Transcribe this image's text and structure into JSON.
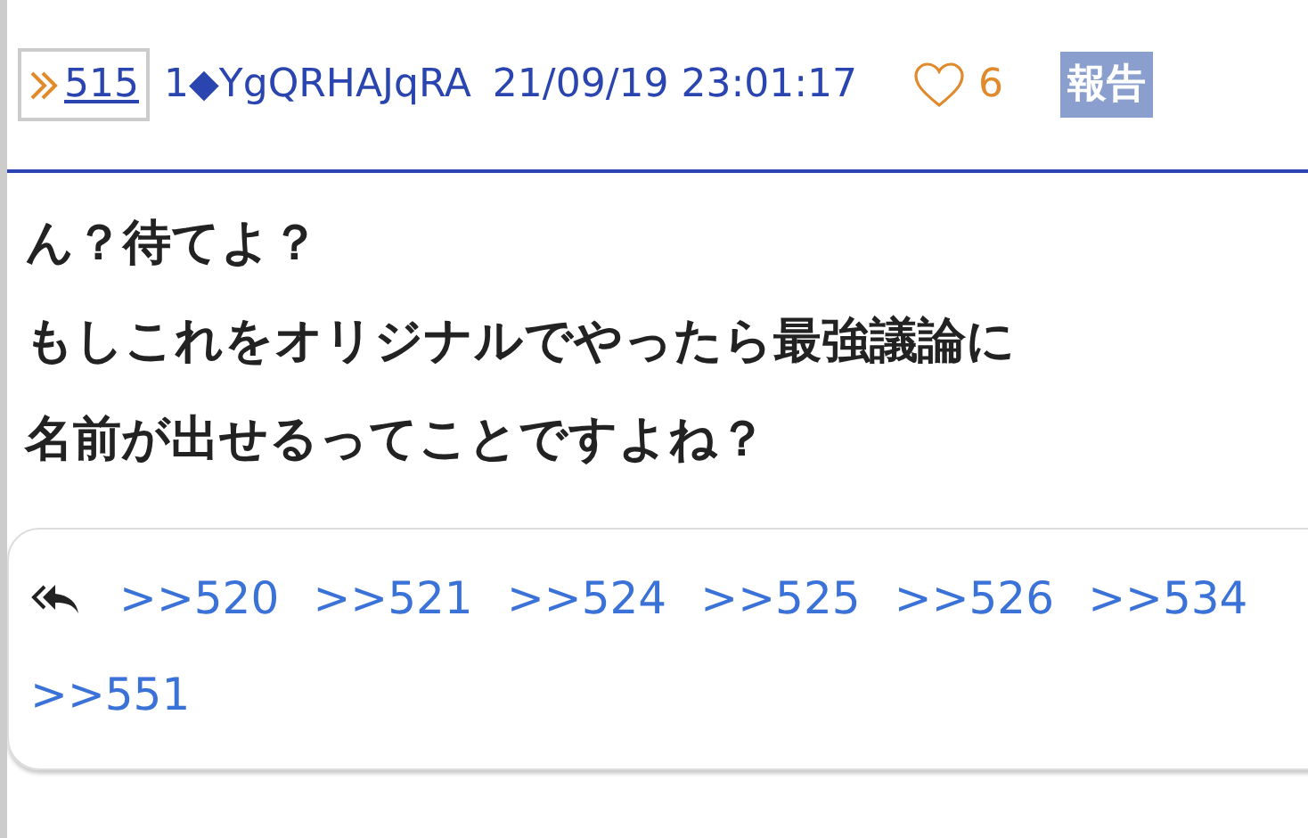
{
  "post": {
    "number": "515",
    "author": "1◆YgQRHAJqRA",
    "datetime": "21/09/19 23:01:17",
    "likes": "6",
    "report": "報告",
    "body": [
      "ん？待てよ？",
      "もしこれをオリジナルでやったら最強議論に",
      "名前が出せるってことですよね？"
    ],
    "replies": [
      ">>520",
      ">>521",
      ">>524",
      ">>525",
      ">>526",
      ">>534",
      ">>551"
    ]
  }
}
